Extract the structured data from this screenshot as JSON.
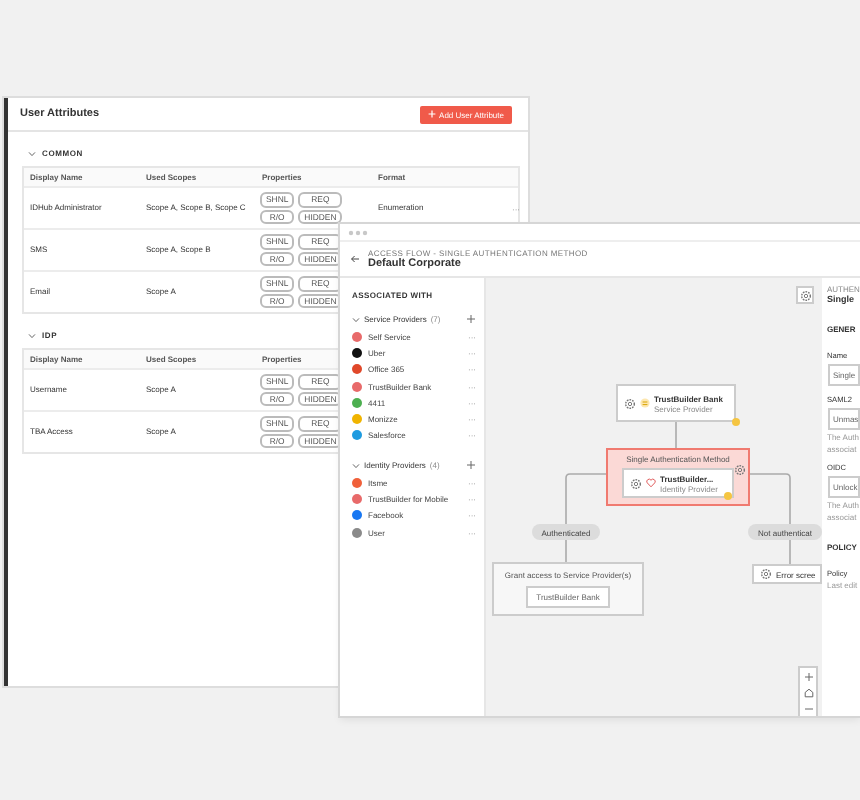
{
  "attributes_window": {
    "title": "User Attributes",
    "add_button": "Add User Attribute",
    "sections": [
      {
        "name": "COMMON",
        "expanded": true,
        "columns": [
          "Display Name",
          "Used Scopes",
          "Properties",
          "Format"
        ],
        "rows": [
          {
            "display_name": "IDHub Administrator",
            "used_scopes": "Scope A, Scope B, Scope C",
            "properties": [
              "SHNL",
              "REQ",
              "R/O",
              "HIDDEN"
            ],
            "format": "Enumeration",
            "menu": "···"
          },
          {
            "display_name": "SMS",
            "used_scopes": "Scope A, Scope B",
            "properties": [
              "SHNL",
              "REQ",
              "R/O",
              "HIDDEN"
            ]
          },
          {
            "display_name": "Email",
            "used_scopes": "Scope A",
            "properties": [
              "SHNL",
              "REQ",
              "R/O",
              "HIDDEN"
            ]
          }
        ]
      },
      {
        "name": "IDP",
        "expanded": true,
        "columns": [
          "Display Name",
          "Used Scopes",
          "Properties"
        ],
        "rows": [
          {
            "display_name": "Username",
            "used_scopes": "Scope A",
            "properties": [
              "SHNL",
              "REQ",
              "R/O",
              "HIDDEN"
            ]
          },
          {
            "display_name": "TBA Access",
            "used_scopes": "Scope A",
            "properties": [
              "SHNL",
              "REQ",
              "R/O",
              "HIDDEN"
            ]
          }
        ]
      }
    ]
  },
  "flow_window": {
    "breadcrumb": "ACCESS FLOW - SINGLE AUTHENTICATION METHOD",
    "title": "Default Corporate",
    "sidebar": {
      "heading": "ASSOCIATED WITH",
      "groups": [
        {
          "name": "Service Providers",
          "count": "(7)",
          "expanded": true,
          "items": [
            {
              "name": "Self Service",
              "color": "#e86a6a",
              "menu": "···"
            },
            {
              "name": "Uber",
              "color": "#111111",
              "menu": "···"
            },
            {
              "name": "Office 365",
              "color": "#e0482a",
              "menu": "···"
            },
            {
              "name": "TrustBuilder Bank",
              "color": "#e86a6a",
              "menu": "···"
            },
            {
              "name": "4411",
              "color": "#4caf50",
              "menu": "···"
            },
            {
              "name": "Monizze",
              "color": "#f0b400",
              "menu": "···"
            },
            {
              "name": "Salesforce",
              "color": "#1e9be0",
              "menu": "···"
            }
          ]
        },
        {
          "name": "Identity Providers",
          "count": "(4)",
          "expanded": true,
          "items": [
            {
              "name": "Itsme",
              "color": "#f0603a",
              "menu": "···"
            },
            {
              "name": "TrustBuilder for Mobile",
              "color": "#e86a6a",
              "menu": "···"
            },
            {
              "name": "Facebook",
              "color": "#1877f2",
              "menu": "···"
            },
            {
              "name": "User",
              "color": "#8a8a8a",
              "menu": "···"
            }
          ]
        }
      ]
    },
    "canvas": {
      "start_node": {
        "title": "TrustBuilder Bank",
        "subtitle": "Service Provider"
      },
      "method_box": {
        "title": "Single Authentication Method",
        "selected": true,
        "node": {
          "title": "TrustBuilder...",
          "subtitle": "Identity Provider"
        }
      },
      "branches": [
        {
          "label": "Authenticated"
        },
        {
          "label": "Not authenticat"
        }
      ],
      "grant_box": {
        "title": "Grant access to Service Provider(s)",
        "item": "TrustBuilder Bank"
      },
      "error_node": {
        "title": "Error scree"
      }
    },
    "panel": {
      "heading": "AUTHEN",
      "title": "Single",
      "section": "GENER",
      "fields": [
        {
          "label": "Name",
          "value": "Single"
        },
        {
          "label": "SAML2",
          "value": "Unmas",
          "help": [
            "The Auth",
            "associat"
          ]
        },
        {
          "label": "OIDC",
          "value": "Unlock",
          "help": [
            "The Auth",
            "associat"
          ]
        }
      ],
      "policy_heading": "POLICY",
      "policy_label": "Policy",
      "policy_note": "Last edit"
    }
  }
}
